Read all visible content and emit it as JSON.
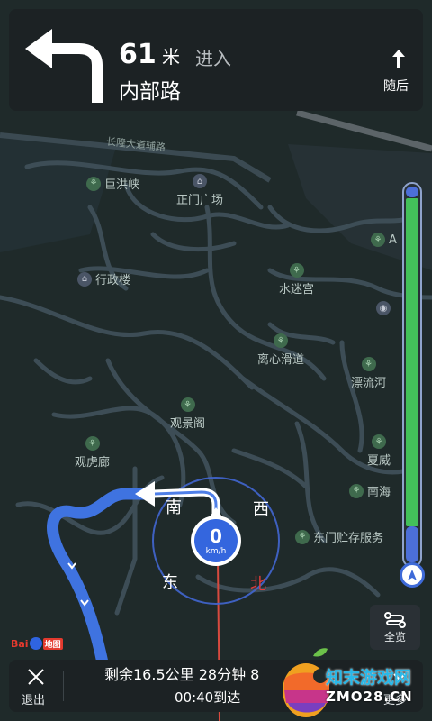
{
  "navigation": {
    "distance_value": "61",
    "distance_unit": "米",
    "action": "进入",
    "road_name": "内部路",
    "next_label": "随后"
  },
  "map": {
    "road_labels": [
      "长隆大道辅路"
    ],
    "pois": [
      {
        "name": "巨洪峡",
        "icon": "park-icon"
      },
      {
        "name": "正门广场",
        "icon": "building-icon"
      },
      {
        "name": "A",
        "icon": "park-icon"
      },
      {
        "name": "行政楼",
        "icon": "building-icon"
      },
      {
        "name": "水迷宫",
        "icon": "park-icon"
      },
      {
        "name": "离心滑道",
        "icon": "park-icon"
      },
      {
        "name": "漂流河",
        "icon": "park-icon"
      },
      {
        "name": "观景阁",
        "icon": "park-icon"
      },
      {
        "name": "观虎廊",
        "icon": "park-icon"
      },
      {
        "name": "夏威",
        "icon": "park-icon"
      },
      {
        "name": "南海",
        "icon": "park-icon"
      },
      {
        "name": "东门贮存服务",
        "icon": "park-icon"
      }
    ],
    "compass": {
      "north": "北",
      "south": "南",
      "east": "东",
      "west": "西"
    },
    "speed": {
      "value": "0",
      "unit": "km/h"
    },
    "logo_text": "Bai du 地图"
  },
  "progress": {
    "traveled_fraction": 0.1
  },
  "overview_button": {
    "label": "全览"
  },
  "bottom_bar": {
    "exit_label": "退出",
    "remaining": "剩余16.5公里 28分钟 8",
    "arrival": "00:40到达",
    "more_label": "更多"
  },
  "watermark": {
    "top": "知末游戏网",
    "bottom": "ZMO28.CN"
  },
  "colors": {
    "map_bg": "#1f2a2a",
    "road": "#3d4d56",
    "route": "#3f73e0",
    "progress_green": "#43c15a",
    "north_red": "#e23b3b"
  }
}
